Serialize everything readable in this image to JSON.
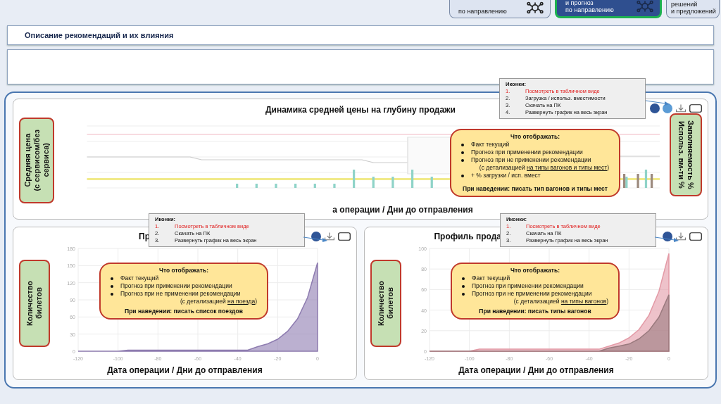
{
  "nav_cards": [
    {
      "lines": [
        "по направлению"
      ],
      "selected": false,
      "icon": true
    },
    {
      "lines": [
        "и прогноз",
        "по направлению"
      ],
      "selected": true,
      "icon": true
    },
    {
      "lines": [
        "решений",
        "и предложений"
      ],
      "selected": false,
      "icon": false
    }
  ],
  "description": {
    "title": "Описание рекомендаций и их влияния"
  },
  "top_chart": {
    "title": "Динамика средней цены на глубину продажи",
    "left_label": "Средняя цена\n(с сервисом/без\nсервиса)",
    "right_label": "Заполняемость %\nИспольз. вм-ти %",
    "x_label": "а операции / Дни до отправления",
    "icon_note": {
      "heading": "Иконки:",
      "items": [
        {
          "number": "1.",
          "text": "Посмотреть в табличном виде",
          "highlight": true
        },
        {
          "number": "2.",
          "text": "Загрузка / использ. вместимости",
          "highlight": false
        },
        {
          "number": "3.",
          "text": "Скачать на ПК",
          "highlight": false
        },
        {
          "number": "4.",
          "text": "Развернуть график на весь экран",
          "highlight": false
        }
      ]
    },
    "callout": {
      "heading": "Что отображать:",
      "items": [
        {
          "kind": "bullet",
          "text": "Факт текущий"
        },
        {
          "kind": "bullet",
          "text": "Прогноз при применении рекомендации"
        },
        {
          "kind": "bullet",
          "text": "Прогноз при не применении рекомендации"
        },
        {
          "kind": "detail",
          "prefix": "(с детализацией ",
          "underlined": "на типы вагонов и типы мест",
          "suffix": ")"
        },
        {
          "kind": "bullet",
          "text": "+ % загрузки / исп. вмест"
        }
      ],
      "hover": "При наведении: писать тип вагонов и типы мест"
    }
  },
  "bottom_charts": [
    {
      "title": "Пр",
      "left_label": "Количество\nбилетов",
      "x_label": "Дата операции / Дни до отправления",
      "icon_note": {
        "heading": "Иконки:",
        "items": [
          {
            "number": "1.",
            "text": "Посмотреть в табличном виде",
            "highlight": true
          },
          {
            "number": "2.",
            "text": "Скачать на ПК",
            "highlight": false
          },
          {
            "number": "3.",
            "text": "Развернуть график на весь экран",
            "highlight": false
          }
        ]
      },
      "callout": {
        "heading": "Что отображать:",
        "items": [
          {
            "kind": "bullet",
            "text": "Факт текущий"
          },
          {
            "kind": "bullet",
            "text": "Прогноз при применении рекомендации"
          },
          {
            "kind": "bullet",
            "text": "Прогноз при не применении рекомендации"
          },
          {
            "kind": "detail",
            "prefix": "(с детализацией ",
            "underlined": "на поезда",
            "suffix": ")"
          }
        ],
        "hover": "При наведении: писать список поездов"
      },
      "chart_data": {
        "type": "area",
        "x": [
          -120,
          -115,
          -110,
          -105,
          -100,
          -95,
          -90,
          -85,
          -80,
          -75,
          -70,
          -65,
          -60,
          -55,
          -50,
          -45,
          -40,
          -35,
          -30,
          -25,
          -20,
          -15,
          -10,
          -5,
          0
        ],
        "series": [
          {
            "color": "#8e7cb0",
            "values": [
              0,
              0,
              0,
              0,
              0,
              2,
              2,
              2,
              2,
              2,
              2,
              2,
              2,
              2,
              2,
              2,
              2,
              2,
              8,
              13,
              21,
              35,
              57,
              94,
              155
            ]
          }
        ],
        "grid": true,
        "xlim": [
          -120,
          0
        ],
        "ylim": [
          0,
          180
        ],
        "xticks": [
          -120,
          -100,
          -80,
          -60,
          -40,
          -20,
          0
        ],
        "yticks": [
          0,
          30,
          60,
          90,
          120,
          150,
          180
        ]
      }
    },
    {
      "title": "Профиль прода",
      "left_label": "Количество\nбилетов",
      "x_label": "Дата операции / Дни до отправления",
      "icon_note": {
        "heading": "Иконки:",
        "items": [
          {
            "number": "1.",
            "text": "Посмотреть в табличном виде",
            "highlight": true
          },
          {
            "number": "2.",
            "text": "Скачать на ПК",
            "highlight": false
          },
          {
            "number": "3.",
            "text": "Развернуть график на весь экран",
            "highlight": false
          }
        ]
      },
      "callout": {
        "heading": "Что отображать:",
        "items": [
          {
            "kind": "bullet",
            "text": "Факт текущий"
          },
          {
            "kind": "bullet",
            "text": "Прогноз при применении рекомендации"
          },
          {
            "kind": "bullet",
            "text": "Прогноз при не применении рекомендации"
          },
          {
            "kind": "detail",
            "prefix": "(с детализацией ",
            "underlined": "на типы вагонов",
            "suffix": ")"
          }
        ],
        "hover": "При наведении: писать типы вагонов"
      },
      "chart_data": {
        "type": "area",
        "x": [
          -120,
          -115,
          -110,
          -105,
          -100,
          -95,
          -90,
          -85,
          -80,
          -75,
          -70,
          -65,
          -60,
          -55,
          -50,
          -45,
          -40,
          -35,
          -30,
          -25,
          -20,
          -15,
          -10,
          -5,
          0
        ],
        "series": [
          {
            "color": "#e39aa6",
            "values": [
              0,
              0,
              0,
              0,
              0,
              2,
              2,
              2,
              2,
              2,
              2,
              2,
              2,
              2,
              2,
              2,
              2,
              2,
              5,
              8,
              13,
              21,
              35,
              58,
              95
            ]
          },
          {
            "color": "#9a7a7e",
            "values": [
              0,
              0,
              0,
              0,
              0,
              0,
              0,
              0,
              0,
              0,
              0,
              0,
              0,
              0,
              0,
              0,
              0,
              0,
              3,
              5,
              7,
              12,
              20,
              33,
              55
            ]
          }
        ],
        "grid": true,
        "xlim": [
          -120,
          0
        ],
        "ylim": [
          0,
          100
        ],
        "xticks": [
          -120,
          -100,
          -80,
          -60,
          -40,
          -20,
          0
        ],
        "yticks": [
          0,
          20,
          40,
          60,
          80,
          100
        ]
      }
    }
  ]
}
